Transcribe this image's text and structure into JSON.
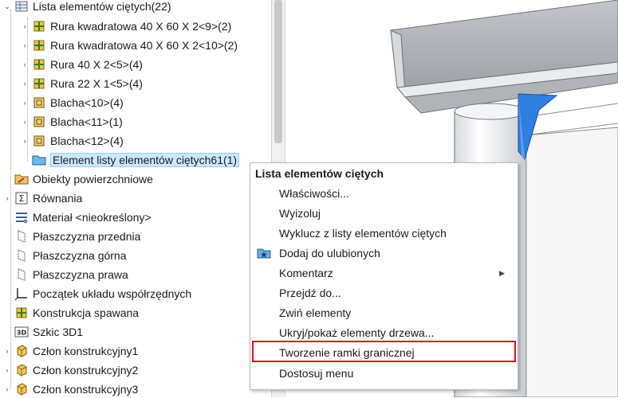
{
  "tree": {
    "items": [
      {
        "label": "Lista elementów ciętych(22)",
        "icon": "cut-list-folder-icon"
      },
      {
        "label": "Rura kwadratowa 40 X 60 X 2<9>(2)",
        "icon": "weldment-member-icon"
      },
      {
        "label": "Rura kwadratowa 40 X 60 X 2<10>(2)",
        "icon": "weldment-member-icon"
      },
      {
        "label": "Rura 40 X 2<5>(4)",
        "icon": "weldment-member-icon"
      },
      {
        "label": "Rura 22 X 1<5>(4)",
        "icon": "weldment-member-icon"
      },
      {
        "label": "Blacha<10>(4)",
        "icon": "sheet-metal-icon"
      },
      {
        "label": "Blacha<11>(1)",
        "icon": "sheet-metal-icon"
      },
      {
        "label": "Blacha<12>(4)",
        "icon": "sheet-metal-icon"
      },
      {
        "label": "Element listy elementów ciętych61(1)",
        "icon": "blue-folder-icon"
      },
      {
        "label": "Obiekty powierzchniowe",
        "icon": "surface-bodies-icon"
      },
      {
        "label": "Równania",
        "icon": "equations-icon"
      },
      {
        "label": "Materiał <nieokreślony>",
        "icon": "material-icon"
      },
      {
        "label": "Płaszczyzna przednia",
        "icon": "plane-icon"
      },
      {
        "label": "Płaszczyzna górna",
        "icon": "plane-icon"
      },
      {
        "label": "Płaszczyzna prawa",
        "icon": "plane-icon"
      },
      {
        "label": "Początek układu współrzędnych",
        "icon": "origin-icon"
      },
      {
        "label": "Konstrukcja spawana",
        "icon": "weldment-icon"
      },
      {
        "label": "Szkic 3D1",
        "icon": "sketch-3d-icon"
      },
      {
        "label": "Człon konstrukcyjny1",
        "icon": "structural-member-icon"
      },
      {
        "label": "Człon konstrukcyjny2",
        "icon": "structural-member-icon"
      },
      {
        "label": "Człon konstrukcyjny3",
        "icon": "structural-member-icon"
      }
    ]
  },
  "menu": {
    "title": "Lista elementów ciętych",
    "items": [
      {
        "label": "Właściwości..."
      },
      {
        "label": "Wyizoluj"
      },
      {
        "label": "Wyklucz z listy elementów ciętych"
      },
      {
        "label": "Dodaj do ulubionych",
        "icon": "favorites-star-icon"
      },
      {
        "label": "Komentarz",
        "submenu": true
      },
      {
        "label": "Przejdź do..."
      },
      {
        "label": "Zwiń elementy"
      },
      {
        "label": "Ukryj/pokaż elementy drzewa..."
      },
      {
        "label": "Tworzenie ramki granicznej",
        "highlighted": true
      },
      {
        "label": "Dostosuj menu"
      }
    ]
  },
  "colors": {
    "selection": "#cce8ff",
    "highlight_border": "#e0101e",
    "model_blue": "#2f7fe0",
    "model_grey": "#b9bcc0"
  }
}
